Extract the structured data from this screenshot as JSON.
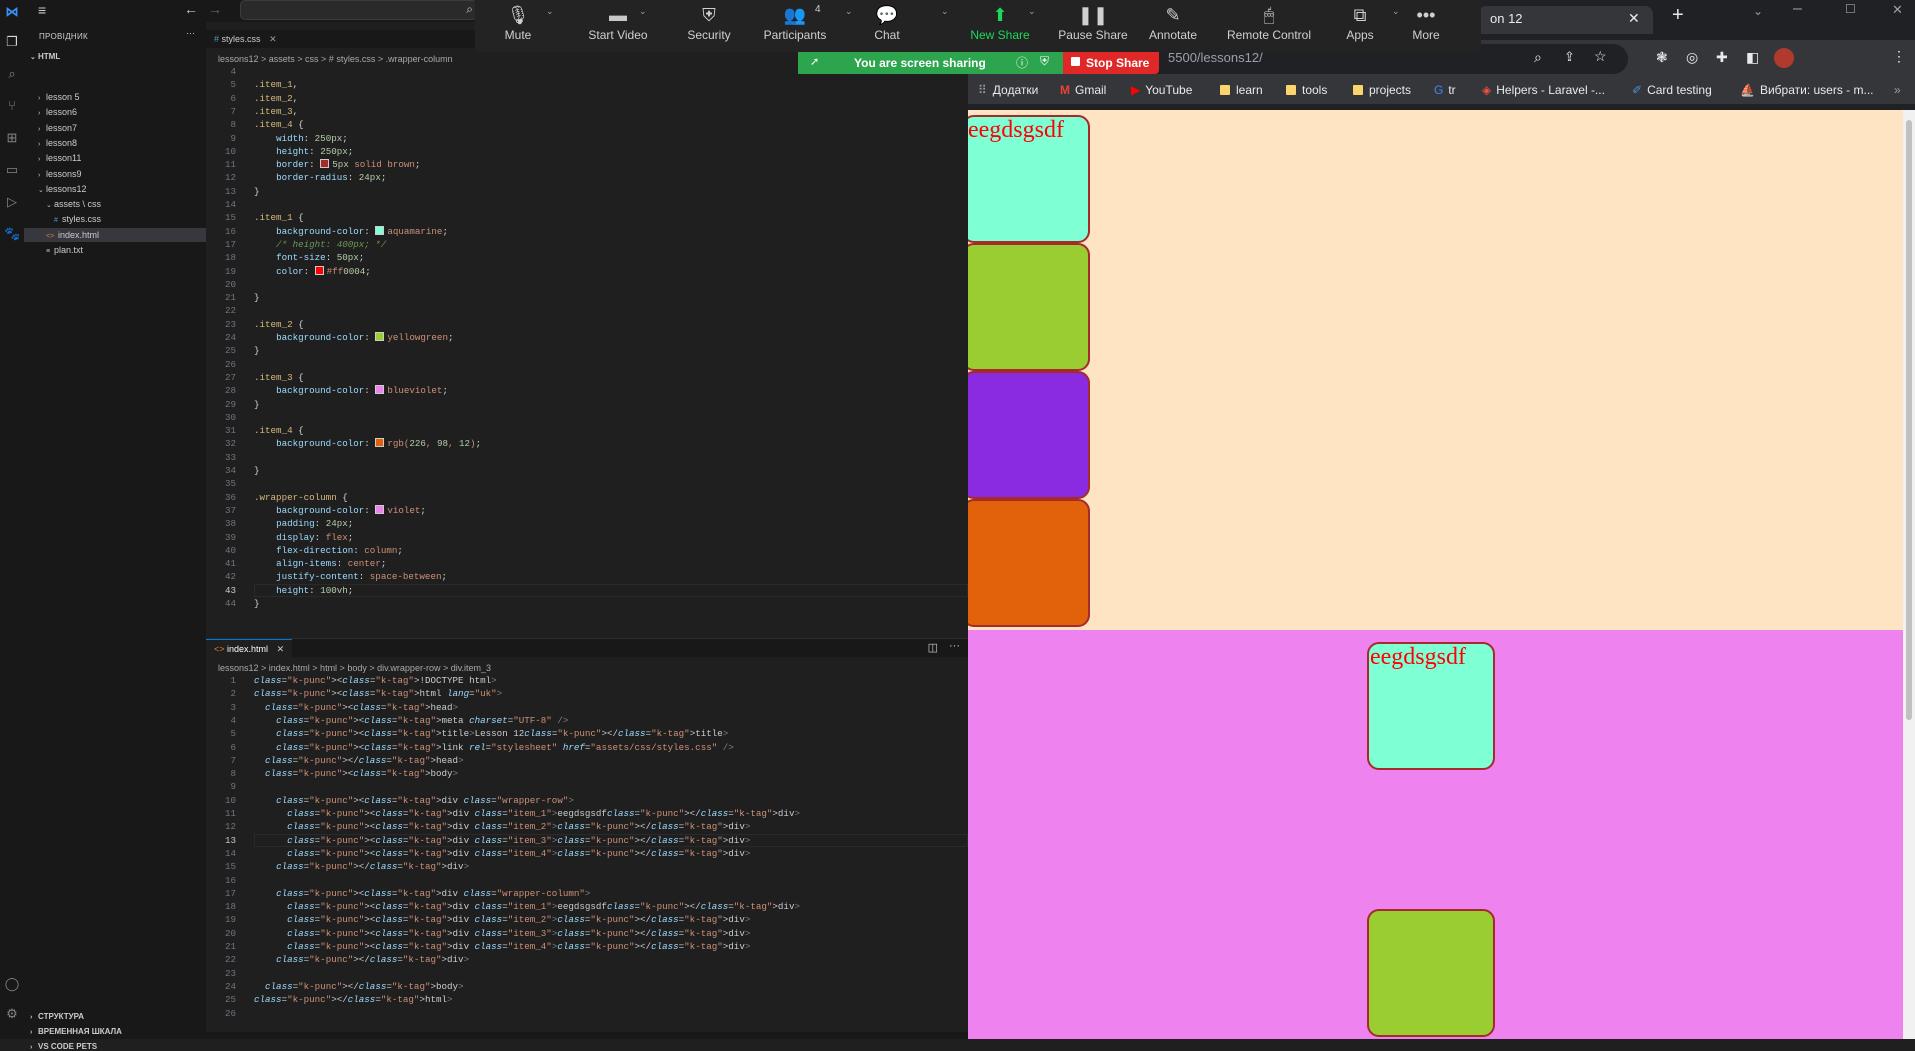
{
  "vscode": {
    "explorer_title": "ПРОВІДНИК",
    "root_folder": "HTML",
    "tree": [
      {
        "label": "lesson 5",
        "indent": 1,
        "twist": "›"
      },
      {
        "label": "lesson6",
        "indent": 1,
        "twist": "›"
      },
      {
        "label": "lesson7",
        "indent": 1,
        "twist": "›"
      },
      {
        "label": "lesson8",
        "indent": 1,
        "twist": "›"
      },
      {
        "label": "lesson11",
        "indent": 1,
        "twist": "›"
      },
      {
        "label": "lessons9",
        "indent": 1,
        "twist": "›"
      },
      {
        "label": "lessons12",
        "indent": 1,
        "twist": "⌄"
      },
      {
        "label": "assets \\ css",
        "indent": 2,
        "twist": "⌄"
      },
      {
        "label": "styles.css",
        "indent": 3,
        "twist": "#"
      },
      {
        "label": "index.html",
        "indent": 2,
        "twist": "<>"
      },
      {
        "label": "plan.txt",
        "indent": 2,
        "twist": "≡"
      }
    ],
    "outline_sections": [
      "СТРУКТУРА",
      "ВРЕМЕННАЯ ШКАЛА",
      "VS CODE PETS"
    ],
    "top_tab": "styles.css",
    "top_crumbs": "lessons12 > assets > css > # styles.css > .wrapper-column",
    "bottom_tab": "index.html",
    "bottom_crumbs": "lessons12 > index.html > html > body > div.wrapper-row > div.item_3",
    "css_lines": [
      {
        "n": "4",
        "t": ""
      },
      {
        "n": "5",
        "t": ".item_1,"
      },
      {
        "n": "6",
        "t": ".item_2,"
      },
      {
        "n": "7",
        "t": ".item_3,"
      },
      {
        "n": "8",
        "t": ".item_4 {"
      },
      {
        "n": "9",
        "t": "    width: 250px;"
      },
      {
        "n": "10",
        "t": "    height: 250px;"
      },
      {
        "n": "11",
        "t": "    border: 5px solid brown;"
      },
      {
        "n": "12",
        "t": "    border-radius: 24px;"
      },
      {
        "n": "13",
        "t": "}"
      },
      {
        "n": "14",
        "t": ""
      },
      {
        "n": "15",
        "t": ".item_1 {"
      },
      {
        "n": "16",
        "t": "    background-color: aquamarine;"
      },
      {
        "n": "17",
        "t": "    /* height: 400px; */"
      },
      {
        "n": "18",
        "t": "    font-size: 50px;"
      },
      {
        "n": "19",
        "t": "    color: #ff0004;"
      },
      {
        "n": "20",
        "t": ""
      },
      {
        "n": "21",
        "t": "}"
      },
      {
        "n": "22",
        "t": ""
      },
      {
        "n": "23",
        "t": ".item_2 {"
      },
      {
        "n": "24",
        "t": "    background-color: yellowgreen;"
      },
      {
        "n": "25",
        "t": "}"
      },
      {
        "n": "26",
        "t": ""
      },
      {
        "n": "27",
        "t": ".item_3 {"
      },
      {
        "n": "28",
        "t": "    background-color: blueviolet;"
      },
      {
        "n": "29",
        "t": "}"
      },
      {
        "n": "30",
        "t": ""
      },
      {
        "n": "31",
        "t": ".item_4 {"
      },
      {
        "n": "32",
        "t": "    background-color: rgb(226, 98, 12);"
      },
      {
        "n": "33",
        "t": ""
      },
      {
        "n": "34",
        "t": "}"
      },
      {
        "n": "35",
        "t": ""
      },
      {
        "n": "36",
        "t": ".wrapper-column {"
      },
      {
        "n": "37",
        "t": "    background-color: violet;"
      },
      {
        "n": "38",
        "t": "    padding: 24px;"
      },
      {
        "n": "39",
        "t": "    display: flex;"
      },
      {
        "n": "40",
        "t": "    flex-direction: column;"
      },
      {
        "n": "41",
        "t": "    align-items: center;"
      },
      {
        "n": "42",
        "t": "    justify-content: space-between;"
      },
      {
        "n": "43",
        "t": "    height: 100vh;"
      },
      {
        "n": "44",
        "t": "}"
      }
    ],
    "html_lines": [
      {
        "n": "1",
        "t": "<!DOCTYPE html>"
      },
      {
        "n": "2",
        "t": "<html lang=\"uk\">"
      },
      {
        "n": "3",
        "t": "  <head>"
      },
      {
        "n": "4",
        "t": "    <meta charset=\"UTF-8\" />"
      },
      {
        "n": "5",
        "t": "    <title>Lesson 12</title>"
      },
      {
        "n": "6",
        "t": "    <link rel=\"stylesheet\" href=\"assets/css/styles.css\" />"
      },
      {
        "n": "7",
        "t": "  </head>"
      },
      {
        "n": "8",
        "t": "  <body>"
      },
      {
        "n": "9",
        "t": ""
      },
      {
        "n": "10",
        "t": "    <div class=\"wrapper-row\">"
      },
      {
        "n": "11",
        "t": "      <div class=\"item_1\">eegdsgsdf</div>"
      },
      {
        "n": "12",
        "t": "      <div class=\"item_2\"></div>"
      },
      {
        "n": "13",
        "t": "      <div class=\"item_3\"></div>"
      },
      {
        "n": "14",
        "t": "      <div class=\"item_4\"></div>"
      },
      {
        "n": "15",
        "t": "    </div>"
      },
      {
        "n": "16",
        "t": ""
      },
      {
        "n": "17",
        "t": "    <div class=\"wrapper-column\">"
      },
      {
        "n": "18",
        "t": "      <div class=\"item_1\">eegdsgsdf</div>"
      },
      {
        "n": "19",
        "t": "      <div class=\"item_2\"></div>"
      },
      {
        "n": "20",
        "t": "      <div class=\"item_3\"></div>"
      },
      {
        "n": "21",
        "t": "      <div class=\"item_4\"></div>"
      },
      {
        "n": "22",
        "t": "    </div>"
      },
      {
        "n": "23",
        "t": ""
      },
      {
        "n": "24",
        "t": "  </body>"
      },
      {
        "n": "25",
        "t": "</html>"
      },
      {
        "n": "26",
        "t": ""
      }
    ]
  },
  "zoom": {
    "buttons": [
      {
        "label": "Mute",
        "icon": "🎙",
        "name": "mute"
      },
      {
        "label": "Start Video",
        "icon": "▬",
        "name": "start-video"
      },
      {
        "label": "Security",
        "icon": "⛨",
        "name": "security"
      },
      {
        "label": "Participants",
        "icon": "👥",
        "name": "participants"
      },
      {
        "label": "Chat",
        "icon": "💬",
        "name": "chat"
      },
      {
        "label": "New Share",
        "icon": "⬆",
        "name": "new-share"
      },
      {
        "label": "Pause Share",
        "icon": "❚❚",
        "name": "pause-share"
      },
      {
        "label": "Annotate",
        "icon": "✎",
        "name": "annotate"
      },
      {
        "label": "Remote Control",
        "icon": "🖱",
        "name": "remote-control"
      },
      {
        "label": "Apps",
        "icon": "⧉",
        "name": "apps"
      },
      {
        "label": "More",
        "icon": "•••",
        "name": "more"
      }
    ],
    "participants_count": "4",
    "sharing_text": "You are screen sharing",
    "stop_share": "Stop Share",
    "new_share_color": "#1dd75b",
    "stop_color": "#e02828"
  },
  "browser": {
    "tab_title": "on 12",
    "url": "5500/lessons12/",
    "bookmarks": [
      "Додатки",
      "Gmail",
      "YouTube",
      "learn",
      "tools",
      "projects",
      "tr",
      "Helpers - Laravel -...",
      "Card testing",
      "Вибрати: users - m..."
    ],
    "item_text": "eegdsgsdf",
    "colors": {
      "body_bg": "#ffe4c4",
      "item_1": "#7fffd4",
      "item_2": "#9acd32",
      "item_3": "#8a2be2",
      "item_4": "#e2620c",
      "wrapper_column": "#ee82ee",
      "border": "#a52a2a"
    }
  }
}
